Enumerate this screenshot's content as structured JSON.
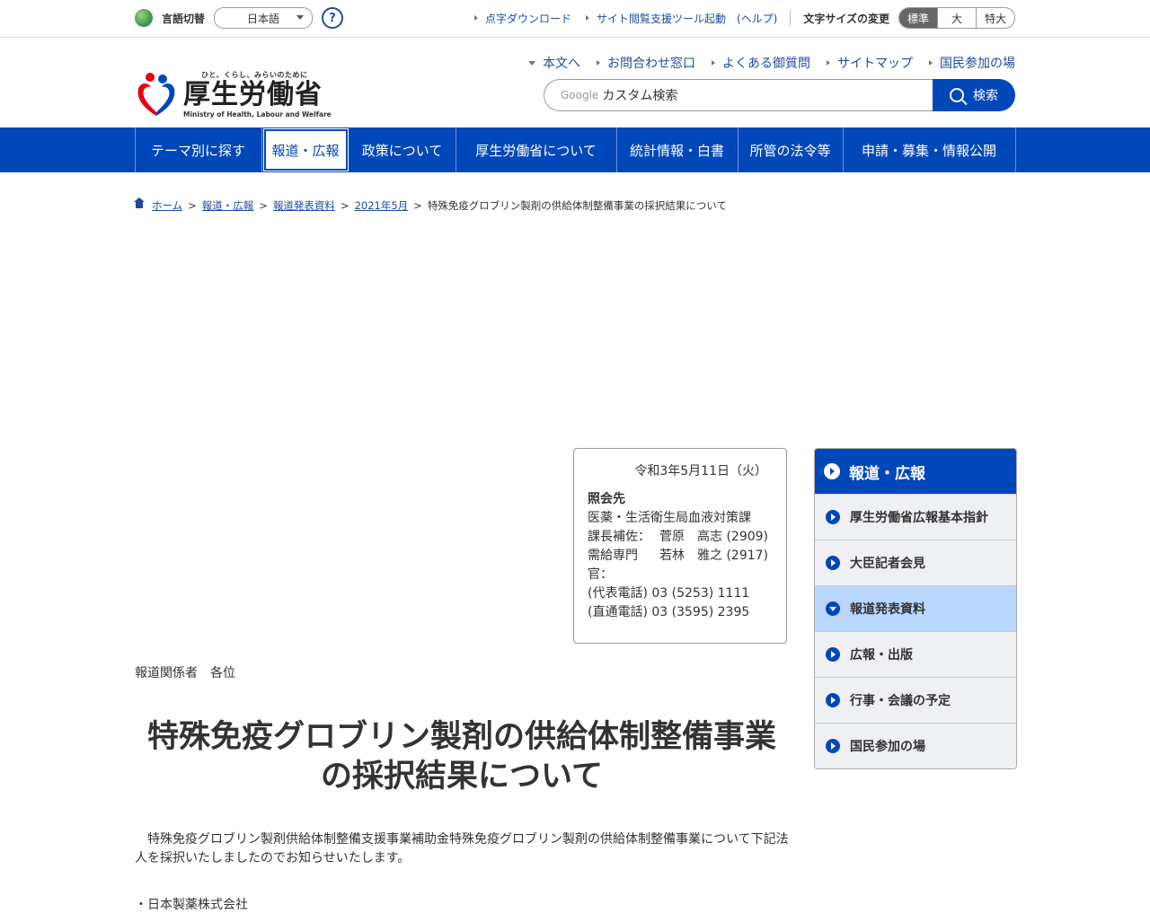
{
  "topbar": {
    "lang_label": "言語切替",
    "lang_selected": "日本語",
    "help": "?",
    "links": [
      "点字ダウンロード",
      "サイト閲覧支援ツール起動　(ヘルプ)"
    ],
    "fontsize_label": "文字サイズの変更",
    "fontsize_options": [
      "標準",
      "大",
      "特大"
    ]
  },
  "header": {
    "logo_tagline": "ひと、くらし、みらいのために",
    "logo_name": "厚生労働省",
    "logo_en": "Ministry of Health, Labour and Welfare",
    "links": [
      "本文へ",
      "お問合わせ窓口",
      "よくある御質問",
      "サイトマップ",
      "国民参加の場"
    ],
    "search_mark": "Google",
    "search_placeholder": "カスタム検索",
    "search_button": "検索"
  },
  "gnav": [
    "テーマ別に探す",
    "報道・広報",
    "政策について",
    "厚生労働省について",
    "統計情報・白書",
    "所管の法令等",
    "申請・募集・情報公開"
  ],
  "breadcrumb": {
    "items": [
      "ホーム",
      "報道・広報",
      "報道発表資料",
      "2021年5月"
    ],
    "current": "特殊免疫グロブリン製剤の供給体制整備事業の採択結果について"
  },
  "contact": {
    "date": "令和3年5月11日（火）",
    "heading": "照会先",
    "department": "医薬・生活衛生局血液対策課",
    "rows": [
      {
        "role": "課長補佐：",
        "name": "菅原　高志 (2909)"
      },
      {
        "role": "需給専門官：",
        "name": "若林　雅之 (2917)"
      }
    ],
    "phones": [
      "(代表電話) 03 (5253) 1111",
      "(直通電話) 03 (3595) 2395"
    ]
  },
  "article": {
    "addressee": "報道関係者　各位",
    "title_line1": "特殊免疫グロブリン製剤の供給体制整備事業",
    "title_line2": "の採択結果について",
    "lead": "特殊免疫グロブリン製剤供給体制整備支援事業補助金特殊免疫グロブリン製剤の供給体制整備事業について下記法人を採択いたしましたのでお知らせいたします。",
    "item": "・日本製薬株式会社"
  },
  "sidenav": {
    "heading": "報道・広報",
    "items": [
      "厚生労働省広報基本指針",
      "大臣記者会見",
      "報道発表資料",
      "広報・出版",
      "行事・会議の予定",
      "国民参加の場"
    ]
  },
  "colors": {
    "brand": "#0047b9",
    "link": "#1d4c9e",
    "current_bg": "#b9d7ff"
  }
}
